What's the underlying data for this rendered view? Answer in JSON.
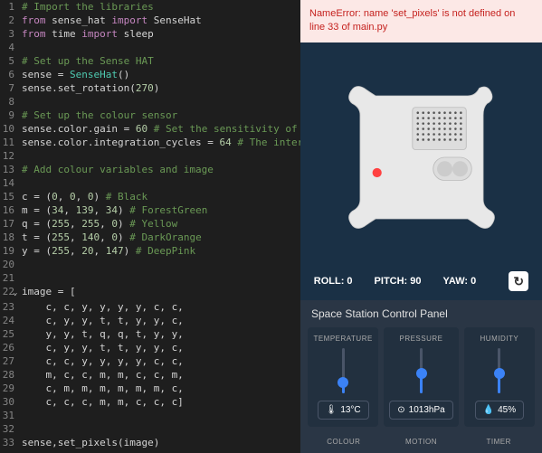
{
  "error": {
    "text": "NameError: name 'set_pixels' is not defined on line 33 of main.py"
  },
  "orientation": {
    "roll_label": "ROLL:",
    "roll": "0",
    "pitch_label": "PITCH:",
    "pitch": "90",
    "yaw_label": "YAW:",
    "yaw": "0"
  },
  "panel": {
    "title": "Space Station Control Panel",
    "sensors": [
      {
        "label": "TEMPERATURE",
        "value": "13°C",
        "icon": "🌡",
        "fill": 25
      },
      {
        "label": "PRESSURE",
        "value": "1013hPa",
        "icon": "⊙",
        "fill": 45
      },
      {
        "label": "HUMIDITY",
        "value": "45%",
        "icon": "💧",
        "fill": 45
      }
    ],
    "row2": [
      "COLOUR",
      "MOTION",
      "TIMER"
    ]
  },
  "code": [
    {
      "n": 1,
      "spans": [
        {
          "t": "# Import the libraries",
          "c": "comment"
        }
      ]
    },
    {
      "n": 2,
      "spans": [
        {
          "t": "from",
          "c": "keyword"
        },
        {
          "t": " sense_hat "
        },
        {
          "t": "import",
          "c": "keyword"
        },
        {
          "t": " SenseHat"
        }
      ]
    },
    {
      "n": 3,
      "spans": [
        {
          "t": "from",
          "c": "keyword"
        },
        {
          "t": " time "
        },
        {
          "t": "import",
          "c": "keyword"
        },
        {
          "t": " sleep"
        }
      ]
    },
    {
      "n": 4,
      "spans": []
    },
    {
      "n": 5,
      "spans": [
        {
          "t": "# Set up the Sense HAT",
          "c": "comment"
        }
      ]
    },
    {
      "n": 6,
      "spans": [
        {
          "t": "sense = "
        },
        {
          "t": "SenseHat",
          "c": "class"
        },
        {
          "t": "()"
        }
      ]
    },
    {
      "n": 7,
      "spans": [
        {
          "t": "sense.set_rotation("
        },
        {
          "t": "270",
          "c": "num"
        },
        {
          "t": ")"
        }
      ]
    },
    {
      "n": 8,
      "spans": []
    },
    {
      "n": 9,
      "spans": [
        {
          "t": "# Set up the colour sensor",
          "c": "comment"
        }
      ]
    },
    {
      "n": 10,
      "spans": [
        {
          "t": "sense.color.gain = "
        },
        {
          "t": "60",
          "c": "num"
        },
        {
          "t": " "
        },
        {
          "t": "# Set the sensitivity of",
          "c": "comment"
        }
      ]
    },
    {
      "n": 11,
      "spans": [
        {
          "t": "sense.color.integration_cycles = "
        },
        {
          "t": "64",
          "c": "num"
        },
        {
          "t": " "
        },
        {
          "t": "# The inter",
          "c": "comment"
        }
      ]
    },
    {
      "n": 12,
      "spans": []
    },
    {
      "n": 13,
      "spans": [
        {
          "t": "# Add colour variables and image",
          "c": "comment"
        }
      ]
    },
    {
      "n": 14,
      "spans": []
    },
    {
      "n": 15,
      "spans": [
        {
          "t": "c = ("
        },
        {
          "t": "0",
          "c": "num"
        },
        {
          "t": ", "
        },
        {
          "t": "0",
          "c": "num"
        },
        {
          "t": ", "
        },
        {
          "t": "0",
          "c": "num"
        },
        {
          "t": ") "
        },
        {
          "t": "# Black",
          "c": "comment"
        }
      ]
    },
    {
      "n": 16,
      "spans": [
        {
          "t": "m = ("
        },
        {
          "t": "34",
          "c": "num"
        },
        {
          "t": ", "
        },
        {
          "t": "139",
          "c": "num"
        },
        {
          "t": ", "
        },
        {
          "t": "34",
          "c": "num"
        },
        {
          "t": ") "
        },
        {
          "t": "# ForestGreen",
          "c": "comment"
        }
      ]
    },
    {
      "n": 17,
      "spans": [
        {
          "t": "q = ("
        },
        {
          "t": "255",
          "c": "num"
        },
        {
          "t": ", "
        },
        {
          "t": "255",
          "c": "num"
        },
        {
          "t": ", "
        },
        {
          "t": "0",
          "c": "num"
        },
        {
          "t": ") "
        },
        {
          "t": "# Yellow",
          "c": "comment"
        }
      ]
    },
    {
      "n": 18,
      "spans": [
        {
          "t": "t = ("
        },
        {
          "t": "255",
          "c": "num"
        },
        {
          "t": ", "
        },
        {
          "t": "140",
          "c": "num"
        },
        {
          "t": ", "
        },
        {
          "t": "0",
          "c": "num"
        },
        {
          "t": ") "
        },
        {
          "t": "# DarkOrange",
          "c": "comment"
        }
      ]
    },
    {
      "n": 19,
      "spans": [
        {
          "t": "y = ("
        },
        {
          "t": "255",
          "c": "num"
        },
        {
          "t": ", "
        },
        {
          "t": "20",
          "c": "num"
        },
        {
          "t": ", "
        },
        {
          "t": "147",
          "c": "num"
        },
        {
          "t": ") "
        },
        {
          "t": "# DeepPink",
          "c": "comment"
        }
      ]
    },
    {
      "n": 20,
      "spans": []
    },
    {
      "n": 21,
      "spans": []
    },
    {
      "n": 22,
      "fold": true,
      "spans": [
        {
          "t": "image = ["
        }
      ]
    },
    {
      "n": 23,
      "spans": [
        {
          "t": "    c, c, y, y, y, y, c, c,"
        }
      ]
    },
    {
      "n": 24,
      "spans": [
        {
          "t": "    c, y, y, t, t, y, y, c,"
        }
      ]
    },
    {
      "n": 25,
      "spans": [
        {
          "t": "    y, y, t, q, q, t, y, y,"
        }
      ]
    },
    {
      "n": 26,
      "spans": [
        {
          "t": "    c, y, y, t, t, y, y, c,"
        }
      ]
    },
    {
      "n": 27,
      "spans": [
        {
          "t": "    c, c, y, y, y, y, c, c,"
        }
      ]
    },
    {
      "n": 28,
      "spans": [
        {
          "t": "    m, c, c, m, m, c, c, m,"
        }
      ]
    },
    {
      "n": 29,
      "spans": [
        {
          "t": "    c, m, m, m, m, m, m, c,"
        }
      ]
    },
    {
      "n": 30,
      "spans": [
        {
          "t": "    c, c, c, m, m, c, c, c]"
        }
      ]
    },
    {
      "n": 31,
      "spans": []
    },
    {
      "n": 32,
      "spans": []
    },
    {
      "n": 33,
      "spans": [
        {
          "t": "sense,set_pixels(image)"
        }
      ]
    }
  ]
}
